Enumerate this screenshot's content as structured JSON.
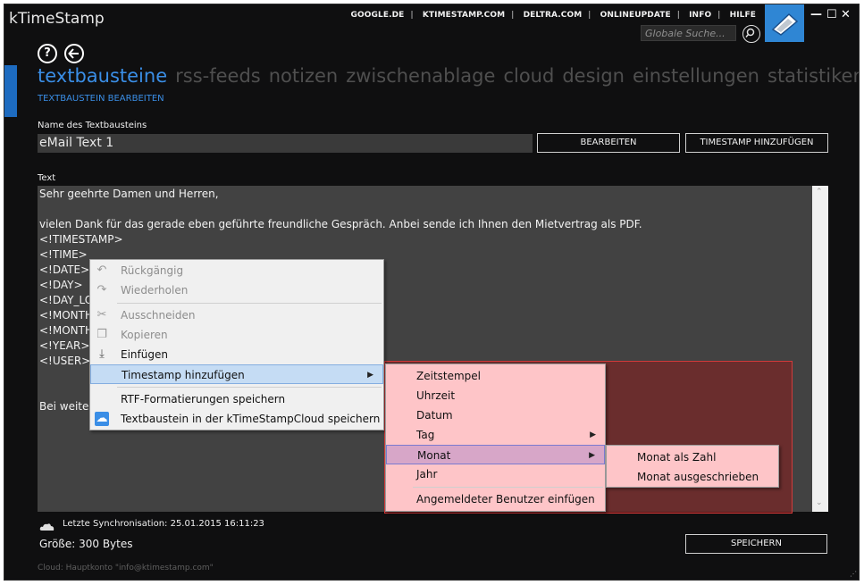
{
  "app": {
    "title": "kTimeStamp"
  },
  "toplinks": [
    "GOOGLE.DE",
    "KTIMESTAMP.COM",
    "DELTRA.COM",
    "ONLINEUPDATE",
    "INFO",
    "HILFE"
  ],
  "search": {
    "placeholder": "Globale Suche..."
  },
  "window_controls": {
    "minimize": "—",
    "maximize": "☐",
    "close": "✕"
  },
  "nav": {
    "tabs": [
      "textbausteine",
      "rss-feeds",
      "notizen",
      "zwischenablage",
      "cloud",
      "design",
      "einstellungen",
      "statistiken"
    ],
    "active": 0
  },
  "subtitle": "TEXTBAUSTEIN BEARBEITEN",
  "form": {
    "name_label": "Name des Textbausteins",
    "name_value": "eMail Text 1",
    "edit_button": "BEARBEITEN",
    "add_timestamp_button": "TIMESTAMP HINZUFÜGEN",
    "text_label": "Text"
  },
  "text_lines": [
    "Sehr geehrte Damen und Herren,",
    "",
    "vielen Dank für das gerade eben geführte freundliche Gespräch. Anbei sende ich Ihnen den Mietvertrag als PDF.",
    "<!TIMESTAMP>",
    "<!TIME>",
    "<!DATE>",
    "<!DAY>",
    "<!DAY_LO",
    "<!MONTH",
    "<!MONTH",
    "<!YEAR>",
    "<!USER>",
    "",
    "",
    "Bei weiter"
  ],
  "context_menu": {
    "items": [
      {
        "label": "Rückgängig",
        "icon": "undo-icon",
        "disabled": true
      },
      {
        "label": "Wiederholen",
        "icon": "redo-icon",
        "disabled": true
      },
      {
        "label": "Ausschneiden",
        "icon": "scissors-icon",
        "disabled": true
      },
      {
        "label": "Kopieren",
        "icon": "copy-icon",
        "disabled": true
      },
      {
        "label": "Einfügen",
        "icon": "paste-icon",
        "disabled": false
      },
      {
        "label": "Timestamp hinzufügen",
        "icon": "",
        "disabled": false,
        "submenu": true,
        "highlighted": true
      },
      {
        "label": "RTF-Formatierungen speichern",
        "icon": "",
        "disabled": false
      },
      {
        "label": "Textbaustein in der kTimeStampCloud speichern",
        "icon": "cloud-upload-icon",
        "disabled": false
      }
    ]
  },
  "timestamp_submenu": {
    "items": [
      "Zeitstempel",
      "Uhrzeit",
      "Datum",
      "Tag",
      "Monat",
      "Jahr",
      "Angemeldeter Benutzer einfügen"
    ]
  },
  "month_submenu": {
    "items": [
      "Monat als Zahl",
      "Monat ausgeschrieben"
    ]
  },
  "footer": {
    "sync": "Letzte Synchronisation: 25.01.2015 16:11:23",
    "size": "Größe: 300 Bytes",
    "save_button": "SPEICHERN",
    "cloud_account": "Cloud: Hauptkonto \"info@ktimestamp.com\""
  }
}
